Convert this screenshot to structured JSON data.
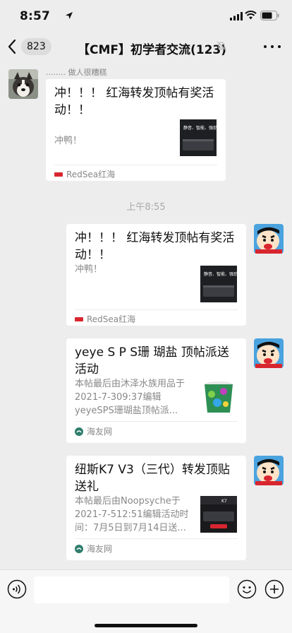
{
  "status_bar": {
    "time": "8:57"
  },
  "nav": {
    "unread_count": "823",
    "title": "【CMF】初学者交流(123)",
    "icons": [
      "chevron-left-icon",
      "mute-bell-icon",
      "more-dots-icon"
    ]
  },
  "messages": [
    {
      "sender": "........ 做人很糟糕",
      "title": "冲！！！ 红海转发顶帖有奖活动！！",
      "desc": "冲鸭！",
      "thumb_text": "静音、智能、强劲",
      "source": "RedSea红海"
    },
    {
      "time_label": "上午8:55"
    },
    {
      "title": "冲！！！ 红海转发顶帖有奖活动！！",
      "desc": "冲鸭！",
      "thumb_text": "静音、智能、强劲",
      "source": "RedSea红海"
    },
    {
      "title": "yeye S P S珊 瑚盐 顶帖派送活动",
      "desc": "本帖最后由沐泽水族用品于2021-7-309:37编辑 yeyeSPS珊瑚盐顶帖派...",
      "source": "海友网"
    },
    {
      "title": "纽斯K7 V3（三代）转发顶贴送礼",
      "desc": "本帖最后由Noopsyche于2021-7-512:51编辑活动时间：7月5日到7月14日送...",
      "source": "海友网"
    }
  ],
  "colors": {
    "background": "#ededed",
    "card": "#ffffff",
    "accent_red": "#d8262f",
    "source_green": "#2f7d6d"
  }
}
